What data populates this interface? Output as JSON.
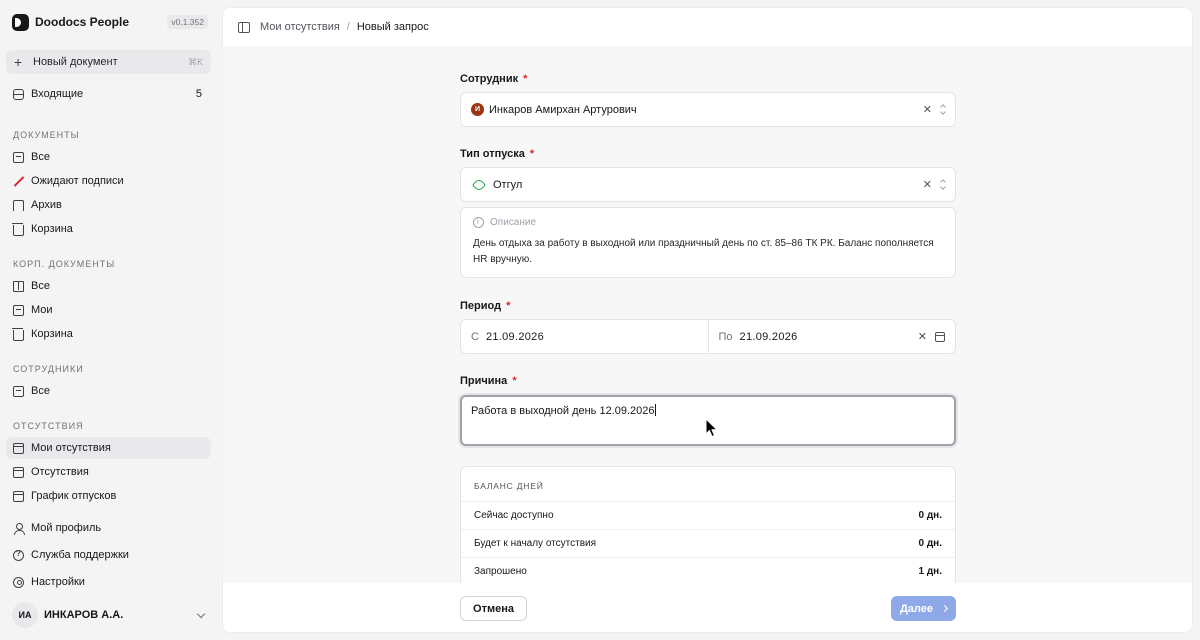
{
  "app": {
    "name": "Doodocs People",
    "version": "v0.1.352"
  },
  "sidebar": {
    "new_doc": {
      "label": "Новый документ",
      "shortcut": "⌘K"
    },
    "inbox": {
      "label": "Входящие",
      "count": "5"
    },
    "sections": [
      {
        "title": "ДОКУМЕНТЫ",
        "items": [
          "Все",
          "Ожидают подписи",
          "Архив",
          "Корзина"
        ]
      },
      {
        "title": "КОРП. ДОКУМЕНТЫ",
        "items": [
          "Все",
          "Мои",
          "Корзина"
        ]
      },
      {
        "title": "СОТРУДНИКИ",
        "items": [
          "Все"
        ]
      },
      {
        "title": "ОТСУТСТВИЯ",
        "items": [
          "Мои отсутствия",
          "Отсутствия",
          "График отпусков"
        ]
      }
    ],
    "bottom": [
      "Мой профиль",
      "Служба поддержки",
      "Настройки"
    ],
    "profile": {
      "initials": "ИА",
      "name": "ИНКАРОВ А.А."
    }
  },
  "breadcrumb": {
    "parent": "Мои отсутствия",
    "separator": "/",
    "current": "Новый запрос"
  },
  "form": {
    "employee": {
      "label": "Сотрудник",
      "required": "*",
      "value": "Инкаров Амирхан Артурович",
      "avatar": "И"
    },
    "leave_type": {
      "label": "Тип отпуска",
      "required": "*",
      "value": "Отгул"
    },
    "description": {
      "heading": "Описание",
      "text": "День отдыха за работу в выходной или праздничный день по ст. 85–86 ТК РК. Баланс пополняется HR вручную."
    },
    "period": {
      "label": "Период",
      "required": "*",
      "from_prefix": "С",
      "from": "21.09.2026",
      "to_prefix": "По",
      "to": "21.09.2026"
    },
    "reason": {
      "label": "Причина",
      "required": "*",
      "value": "Работа в выходной день 12.09.2026"
    },
    "balance": {
      "title": "БАЛАНС ДНЕЙ",
      "rows": [
        {
          "label": "Сейчас доступно",
          "value": "0 дн."
        },
        {
          "label": "Будет к началу отсутствия",
          "value": "0 дн."
        },
        {
          "label": "Запрошено",
          "value": "1 дн."
        }
      ]
    }
  },
  "footer": {
    "cancel": "Отмена",
    "next": "Далее"
  },
  "colors": {
    "accent_disabled": "#8fa9e8",
    "required": "#dc2626",
    "tag": "#16a34a"
  }
}
